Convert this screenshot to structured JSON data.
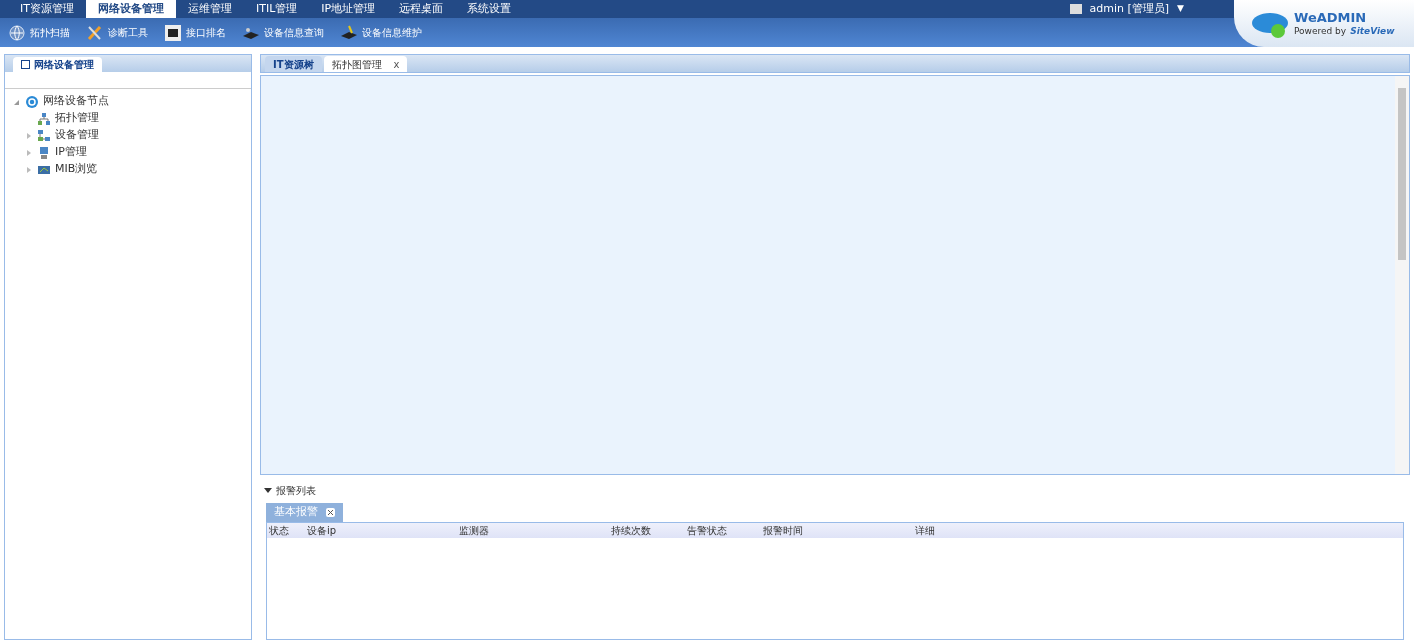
{
  "menu": [
    {
      "label": "IT资源管理",
      "selected": false
    },
    {
      "label": "网络设备管理",
      "selected": true
    },
    {
      "label": "运维管理",
      "selected": false
    },
    {
      "label": "ITIL管理",
      "selected": false
    },
    {
      "label": "IP地址管理",
      "selected": false
    },
    {
      "label": "远程桌面",
      "selected": false
    },
    {
      "label": "系统设置",
      "selected": false
    }
  ],
  "user": {
    "label": "admin [管理员]",
    "caret": "▼"
  },
  "brand": {
    "title": "WeADMIN",
    "powered": "Powered by",
    "product": "SiteView"
  },
  "toolbar": [
    {
      "label": "拓扑扫描",
      "kind": "globe"
    },
    {
      "label": "诊断工具",
      "kind": "tools"
    },
    {
      "label": "接口排名",
      "kind": "port"
    },
    {
      "label": "设备信息查询",
      "kind": "device"
    },
    {
      "label": "设备信息维护",
      "kind": "device-edit"
    }
  ],
  "sidebar": {
    "title": "网络设备管理",
    "tree": [
      {
        "label": "网络设备节点",
        "kind": "root",
        "expanded": true,
        "children": [
          {
            "label": "拓扑管理",
            "kind": "topology"
          },
          {
            "label": "设备管理",
            "kind": "network",
            "expanded": false
          },
          {
            "label": "IP管理",
            "kind": "computer",
            "expanded": false
          },
          {
            "label": "MIB浏览",
            "kind": "monitor",
            "expanded": false
          }
        ]
      }
    ]
  },
  "tabs": [
    {
      "label": "IT资源树",
      "selected": false,
      "closable": false
    },
    {
      "label": "拓扑图管理",
      "selected": true,
      "closable": true,
      "close": "x"
    }
  ],
  "alarm_panel": {
    "title": "报警列表",
    "tabs": [
      {
        "label": "基本报警",
        "selected": true
      }
    ],
    "columns": [
      "状态",
      "设备ip",
      "监测器",
      "持续次数",
      "告警状态",
      "报警时间",
      "详细"
    ]
  }
}
